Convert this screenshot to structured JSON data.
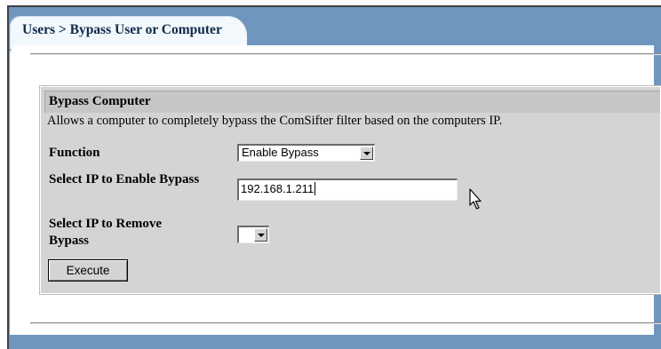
{
  "breadcrumb": "Users > Bypass User or Computer",
  "section": {
    "title": "Bypass Computer",
    "description": "Allows a computer to completely bypass the ComSifter filter based on the computers IP."
  },
  "form": {
    "function_label": "Function",
    "function_value": "Enable Bypass",
    "enable_label": "Select IP to Enable Bypass",
    "enable_value": "192.168.1.211",
    "remove_label": "Select IP to Remove Bypass",
    "remove_value": "",
    "execute_label": "Execute"
  },
  "icons": {
    "dropdown": "chevron-down-icon",
    "cursor": "mouse-pointer-icon"
  },
  "colors": {
    "frame_blue": "#6f97be",
    "box_gray": "#d4d4d4",
    "header_gray": "#c6c6c6"
  }
}
